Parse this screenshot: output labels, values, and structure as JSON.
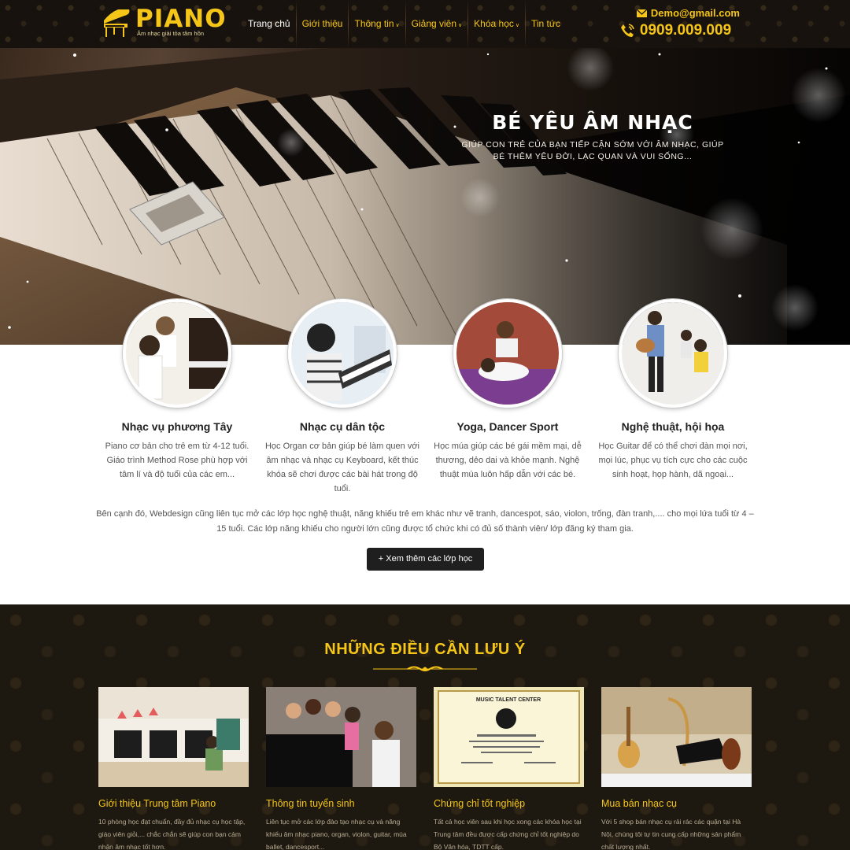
{
  "header": {
    "logo_text": "PIANO",
    "logo_sub": "Âm nhạc giải tỏa tâm hồn",
    "nav": [
      {
        "label": "Trang chủ",
        "active": true,
        "dropdown": false
      },
      {
        "label": "Giới thiệu",
        "active": false,
        "dropdown": false
      },
      {
        "label": "Thông tin",
        "active": false,
        "dropdown": true
      },
      {
        "label": "Giảng viên",
        "active": false,
        "dropdown": true
      },
      {
        "label": "Khóa học",
        "active": false,
        "dropdown": true
      },
      {
        "label": "Tin tức",
        "active": false,
        "dropdown": false
      }
    ],
    "email": "Demo@gmail.com",
    "phone": "0909.009.009"
  },
  "hero": {
    "title": "BÉ YÊU ÂM NHẠC",
    "subtitle": "GIÚP CON TRẺ CỦA BẠN TIẾP CẬN SỚM VỚI ÂM NHẠC, GIÚP BÉ THÊM YÊU ĐỜI, LẠC QUAN VÀ VUI SỐNG..."
  },
  "features": [
    {
      "title": "Nhạc vụ phương Tây",
      "desc": "Piano cơ bản cho trẻ em từ 4-12 tuổi. Giáo trình Method Rose phù hợp với tâm lí và độ tuổi của các em..."
    },
    {
      "title": "Nhạc cụ dân tộc",
      "desc": "Học Organ cơ bản giúp bé làm quen với âm nhạc và  nhạc cụ Keyboard, kết thúc khóa sẽ chơi được các bài hát trong độ tuổi."
    },
    {
      "title": "Yoga, Dancer Sport",
      "desc": "Học múa giúp các bé gái mềm mại, dễ thương, dẻo dai và khỏe mạnh. Nghệ thuật múa luôn hấp dẫn với các bé."
    },
    {
      "title": "Nghệ thuật, hội họa",
      "desc": "Học Guitar để có thể chơi đàn mọi nơi, mọi lúc, phục vụ tích cực cho các cuộc sinh hoạt, họp hành, dã ngoại..."
    }
  ],
  "more": {
    "text": "Bên cạnh đó, Webdesign cũng liên tục mở các lớp học nghệ thuật, năng khiếu trẻ em khác như vẽ tranh, dancespot, sáo, violon, trống, đàn tranh,.... cho mọi lứa tuổi từ 4 – 15 tuổi. Các lớp năng khiếu cho người lớn cũng được tổ chức khi có đủ số thành viên/ lớp đăng ký tham gia.",
    "button": "+ Xem thêm các lớp học"
  },
  "notes": {
    "title": "NHỮNG ĐIỀU CẦN LƯU Ý",
    "cards": [
      {
        "title": "Giới thiệu Trung tâm Piano",
        "desc": "10 phòng học đạt chuẩn, đầy đủ nhạc cụ học tập, giáo viên giỏi,... chắc chắn sẽ giúp con bạn cảm nhận âm nhạc tốt hơn."
      },
      {
        "title": "Thông tin tuyển sinh",
        "desc": "Liên tục mở các lớp đào tạo nhạc cụ và năng khiếu âm nhạc piano, organ, violon, guitar, múa ballet, dancesport..."
      },
      {
        "title": "Chứng chỉ tốt nghiệp",
        "desc": "Tất cả học viên sau khi học xong các khóa học tại Trung tâm đều được cấp chứng chỉ tốt nghiệp do Bộ Văn hóa, TDTT cấp."
      },
      {
        "title": "Mua bán nhạc cụ",
        "desc": "Với 5 shop bán nhạc cụ rải rác các quận tại Hà Nội, chúng tôi tự tin cung cấp những sản phẩm chất lượng nhất."
      }
    ],
    "certificate_text": "MUSIC TALENT CENTER"
  }
}
